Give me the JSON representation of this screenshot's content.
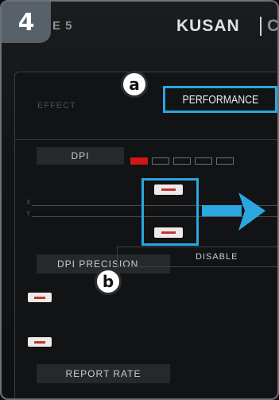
{
  "step": {
    "number": "4"
  },
  "header": {
    "tab_fragment": "E 5",
    "product": "KUSAN",
    "tab_fragment_right": "C"
  },
  "tabs": {
    "effect_label": "EFFECT",
    "performance_label": "PERFORMANCE"
  },
  "callouts": {
    "a": "a",
    "b": "b"
  },
  "dpi": {
    "label": "DPI",
    "levels_total": 5,
    "active_level": 1
  },
  "dpi_precision": {
    "label": "DPI PRECISION",
    "value": "DISABLE"
  },
  "report_rate": {
    "label": "REPORT RATE"
  },
  "axis_labels": {
    "x_top": "X",
    "y_top": "Y"
  },
  "colors": {
    "highlight": "#2ba6e0",
    "active_indicator": "#d2161a",
    "badge": "#58616a"
  },
  "icons": {
    "arrow": "arrow-right-icon"
  }
}
